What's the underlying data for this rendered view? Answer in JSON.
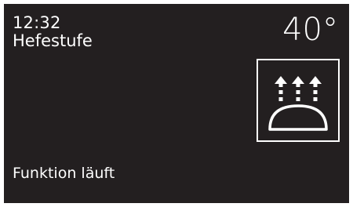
{
  "display": {
    "time": "12:32",
    "program_name": "Hefestufe",
    "temperature": "40°",
    "status_text": "Funktion läuft",
    "mode_icon": "proofing-warm-air-icon"
  },
  "colors": {
    "screen_background": "#231f20",
    "foreground": "#ffffff",
    "frame": "#ffffff"
  }
}
